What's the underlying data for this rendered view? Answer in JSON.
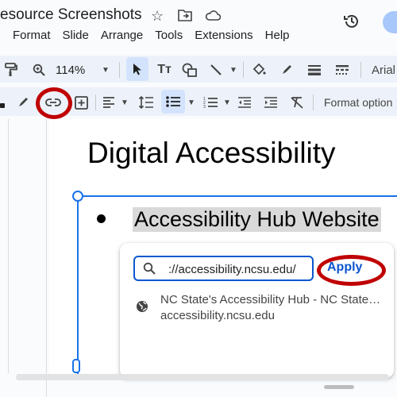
{
  "header": {
    "doc_title": "esource Screenshots",
    "star_icon": "star-icon",
    "folder_icon": "move-folder-icon",
    "cloud_icon": "cloud-icon",
    "history_icon": "history-icon"
  },
  "menu": [
    "Format",
    "Slide",
    "Arrange",
    "Tools",
    "Extensions",
    "Help"
  ],
  "toolbar1": {
    "zoom": "114%",
    "font": "Arial"
  },
  "toolbar2": {
    "format_options": "Format option"
  },
  "slide": {
    "title": "Digital Accessibility",
    "bullet": "Accessibility Hub Website"
  },
  "link_popup": {
    "input_value": "://accessibility.ncsu.edu/",
    "apply_label": "Apply",
    "suggestion_title": "NC State's Accessibility Hub - NC State…",
    "suggestion_url": "accessibility.ncsu.edu"
  },
  "colors": {
    "accent": "#1a73e8",
    "annotation": "#c00000",
    "toolbar_bg": "#edf2fa"
  }
}
